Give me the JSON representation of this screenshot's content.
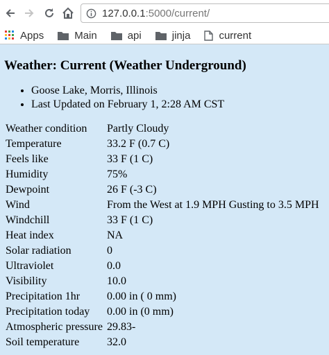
{
  "browser": {
    "url_host": "127.0.0.1",
    "url_path": ":5000/current/",
    "bookmarks": [
      {
        "label": "Apps",
        "icon": "apps-grid-icon"
      },
      {
        "label": "Main",
        "icon": "folder-icon"
      },
      {
        "label": "api",
        "icon": "folder-icon"
      },
      {
        "label": "jinja",
        "icon": "folder-icon"
      },
      {
        "label": "current",
        "icon": "page-icon"
      }
    ],
    "colors": {
      "apps_grid": [
        "#e53935",
        "#43a047",
        "#1e88e5",
        "#fbc02d"
      ]
    }
  },
  "page": {
    "title": "Weather: Current (Weather Underground)",
    "location": "Goose Lake, Morris, Illinois",
    "updated": "Last Updated on February 1, 2:28 AM CST",
    "background": "#d4e8f7",
    "rows": [
      {
        "label": "Weather condition",
        "value": "Partly Cloudy"
      },
      {
        "label": "Temperature",
        "value": "33.2 F (0.7 C)"
      },
      {
        "label": "Feels like",
        "value": "33 F (1 C)"
      },
      {
        "label": "Humidity",
        "value": "75%"
      },
      {
        "label": "Dewpoint",
        "value": "26 F (-3 C)"
      },
      {
        "label": "Wind",
        "value": "From the West at 1.9 MPH Gusting to 3.5 MPH"
      },
      {
        "label": "Windchill",
        "value": "33 F (1 C)"
      },
      {
        "label": "Heat index",
        "value": "NA"
      },
      {
        "label": "Solar radiation",
        "value": "0"
      },
      {
        "label": "Ultraviolet",
        "value": "0.0"
      },
      {
        "label": "Visibility",
        "value": "10.0"
      },
      {
        "label": "Precipitation 1hr",
        "value": "0.00 in ( 0 mm)"
      },
      {
        "label": "Precipitation today",
        "value": "0.00 in (0 mm)"
      },
      {
        "label": "Atmospheric pressure",
        "value": "29.83-"
      },
      {
        "label": "Soil temperature",
        "value": "32.0"
      }
    ]
  }
}
